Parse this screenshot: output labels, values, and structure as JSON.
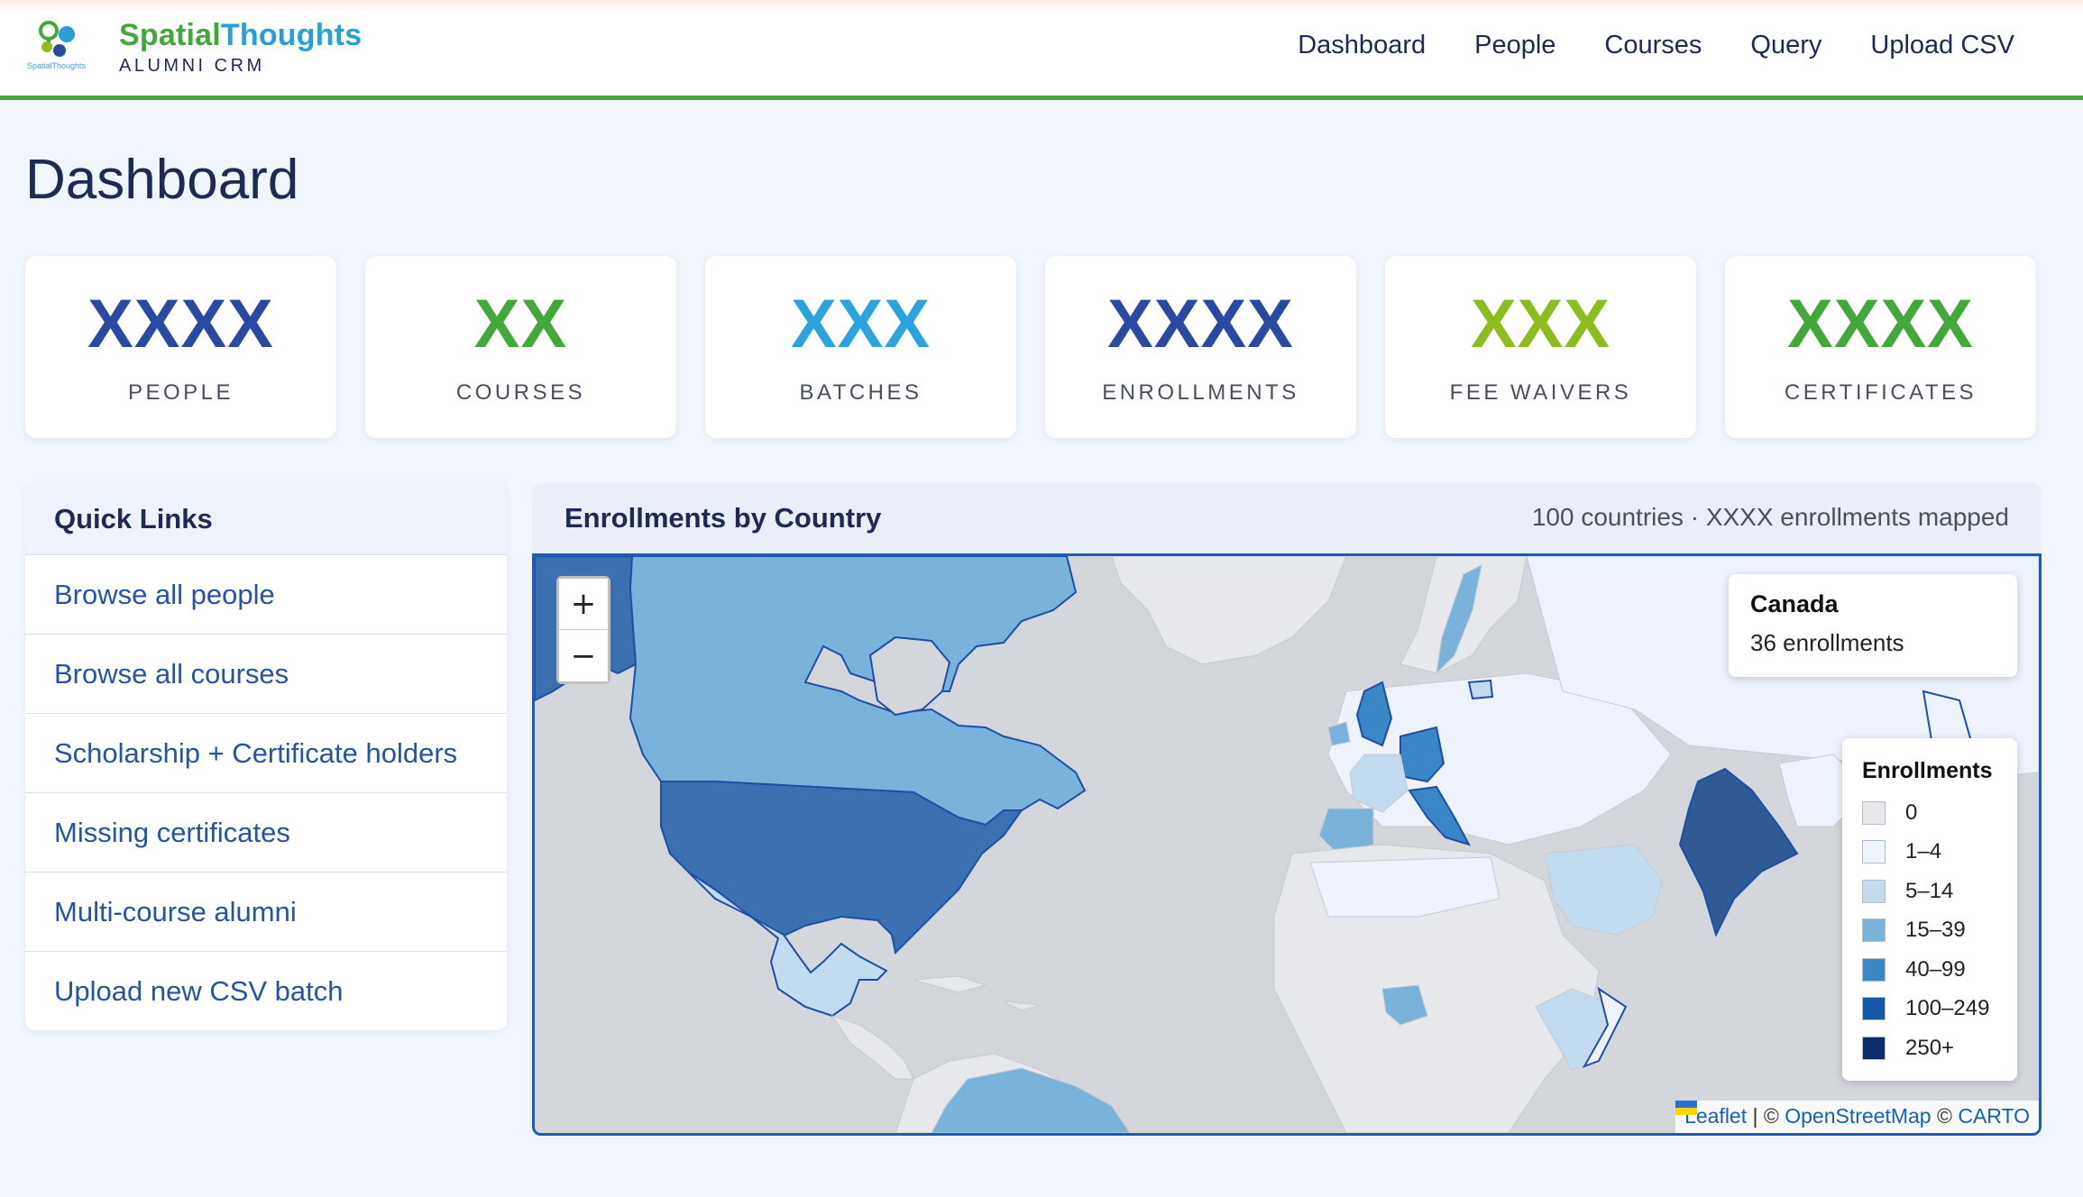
{
  "brand": {
    "name_part1": "Spatial",
    "name_part2": "Thoughts",
    "subtitle": "ALUMNI CRM",
    "logo_wordmark": "SpatialThoughts"
  },
  "nav": {
    "items": [
      "Dashboard",
      "People",
      "Courses",
      "Query",
      "Upload CSV"
    ]
  },
  "page_title": "Dashboard",
  "stats": [
    {
      "value": "XXXX",
      "label": "PEOPLE",
      "color": "#2a4aa2"
    },
    {
      "value": "XX",
      "label": "COURSES",
      "color": "#43a83a"
    },
    {
      "value": "XXX",
      "label": "BATCHES",
      "color": "#2ba4dd"
    },
    {
      "value": "XXXX",
      "label": "ENROLLMENTS",
      "color": "#2a4aa2"
    },
    {
      "value": "XXX",
      "label": "FEE WAIVERS",
      "color": "#8cbd1f"
    },
    {
      "value": "XXXX",
      "label": "CERTIFICATES",
      "color": "#43a83a"
    }
  ],
  "quick_links": {
    "title": "Quick Links",
    "items": [
      "Browse all people",
      "Browse all courses",
      "Scholarship + Certificate holders",
      "Missing certificates",
      "Multi-course alumni",
      "Upload new CSV batch"
    ]
  },
  "map": {
    "title": "Enrollments by Country",
    "meta": "100 countries · XXXX enrollments mapped",
    "zoom_in": "+",
    "zoom_out": "−",
    "hover": {
      "country": "Canada",
      "count_text": "36 enrollments"
    },
    "legend": {
      "title": "Enrollments",
      "bins": [
        {
          "label": "0",
          "color": "#e6e8eb"
        },
        {
          "label": "1–4",
          "color": "#eef2fc"
        },
        {
          "label": "5–14",
          "color": "#c2dbee"
        },
        {
          "label": "15–39",
          "color": "#79b3db"
        },
        {
          "label": "40–99",
          "color": "#3a86c7"
        },
        {
          "label": "100–249",
          "color": "#1359a8"
        },
        {
          "label": "250+",
          "color": "#0b2d6a"
        }
      ]
    },
    "attribution": {
      "leaflet": "Leaflet",
      "separator": " | © ",
      "osm": "OpenStreetMap",
      "copyright": " © ",
      "carto": "CARTO"
    }
  }
}
